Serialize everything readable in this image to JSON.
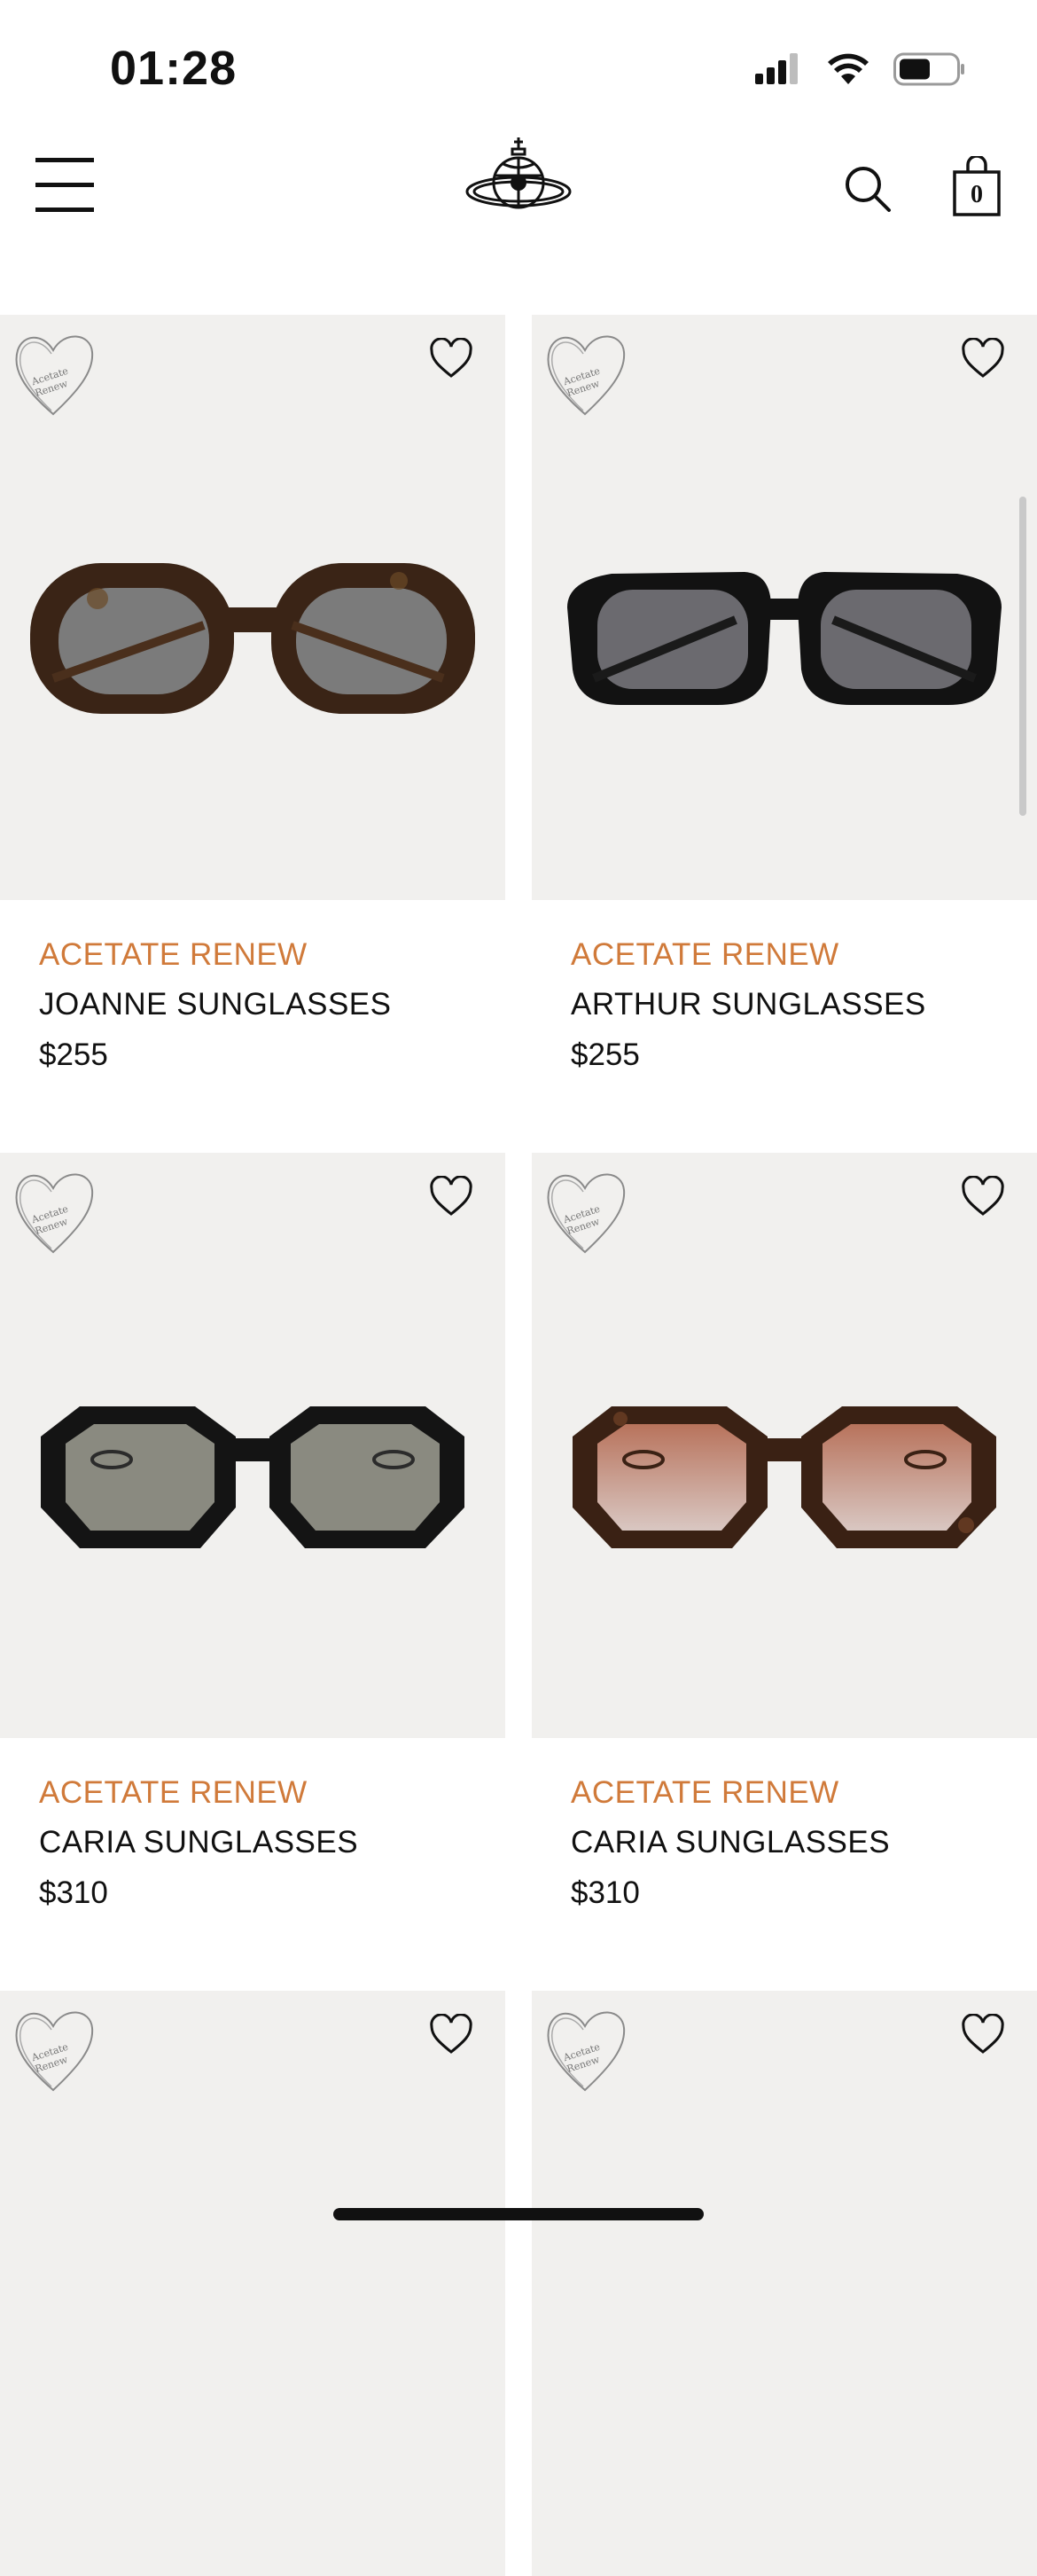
{
  "status_bar": {
    "time": "01:28"
  },
  "header": {
    "bag_count": "0"
  },
  "products": [
    {
      "collection": "ACETATE RENEW",
      "name": "JOANNE SUNGLASSES",
      "price": "$255",
      "frame_color": "#3a2416",
      "lens_color": "#7b7b7b",
      "style": "round"
    },
    {
      "collection": "ACETATE RENEW",
      "name": "ARTHUR SUNGLASSES",
      "price": "$255",
      "frame_color": "#121212",
      "lens_color": "#6b6a6f",
      "style": "square"
    },
    {
      "collection": "ACETATE RENEW",
      "name": "CARIA SUNGLASSES",
      "price": "$310",
      "frame_color": "#141414",
      "lens_color": "#8a8a80",
      "style": "hex"
    },
    {
      "collection": "ACETATE RENEW",
      "name": "CARIA SUNGLASSES",
      "price": "$310",
      "frame_color": "#3a2114",
      "lens_color": "#c48a74",
      "style": "hex"
    },
    {
      "collection": "",
      "name": "",
      "price": ""
    },
    {
      "collection": "",
      "name": "",
      "price": ""
    }
  ],
  "colors": {
    "accent": "#d07a3a",
    "image_bg": "#f1f0ee"
  }
}
